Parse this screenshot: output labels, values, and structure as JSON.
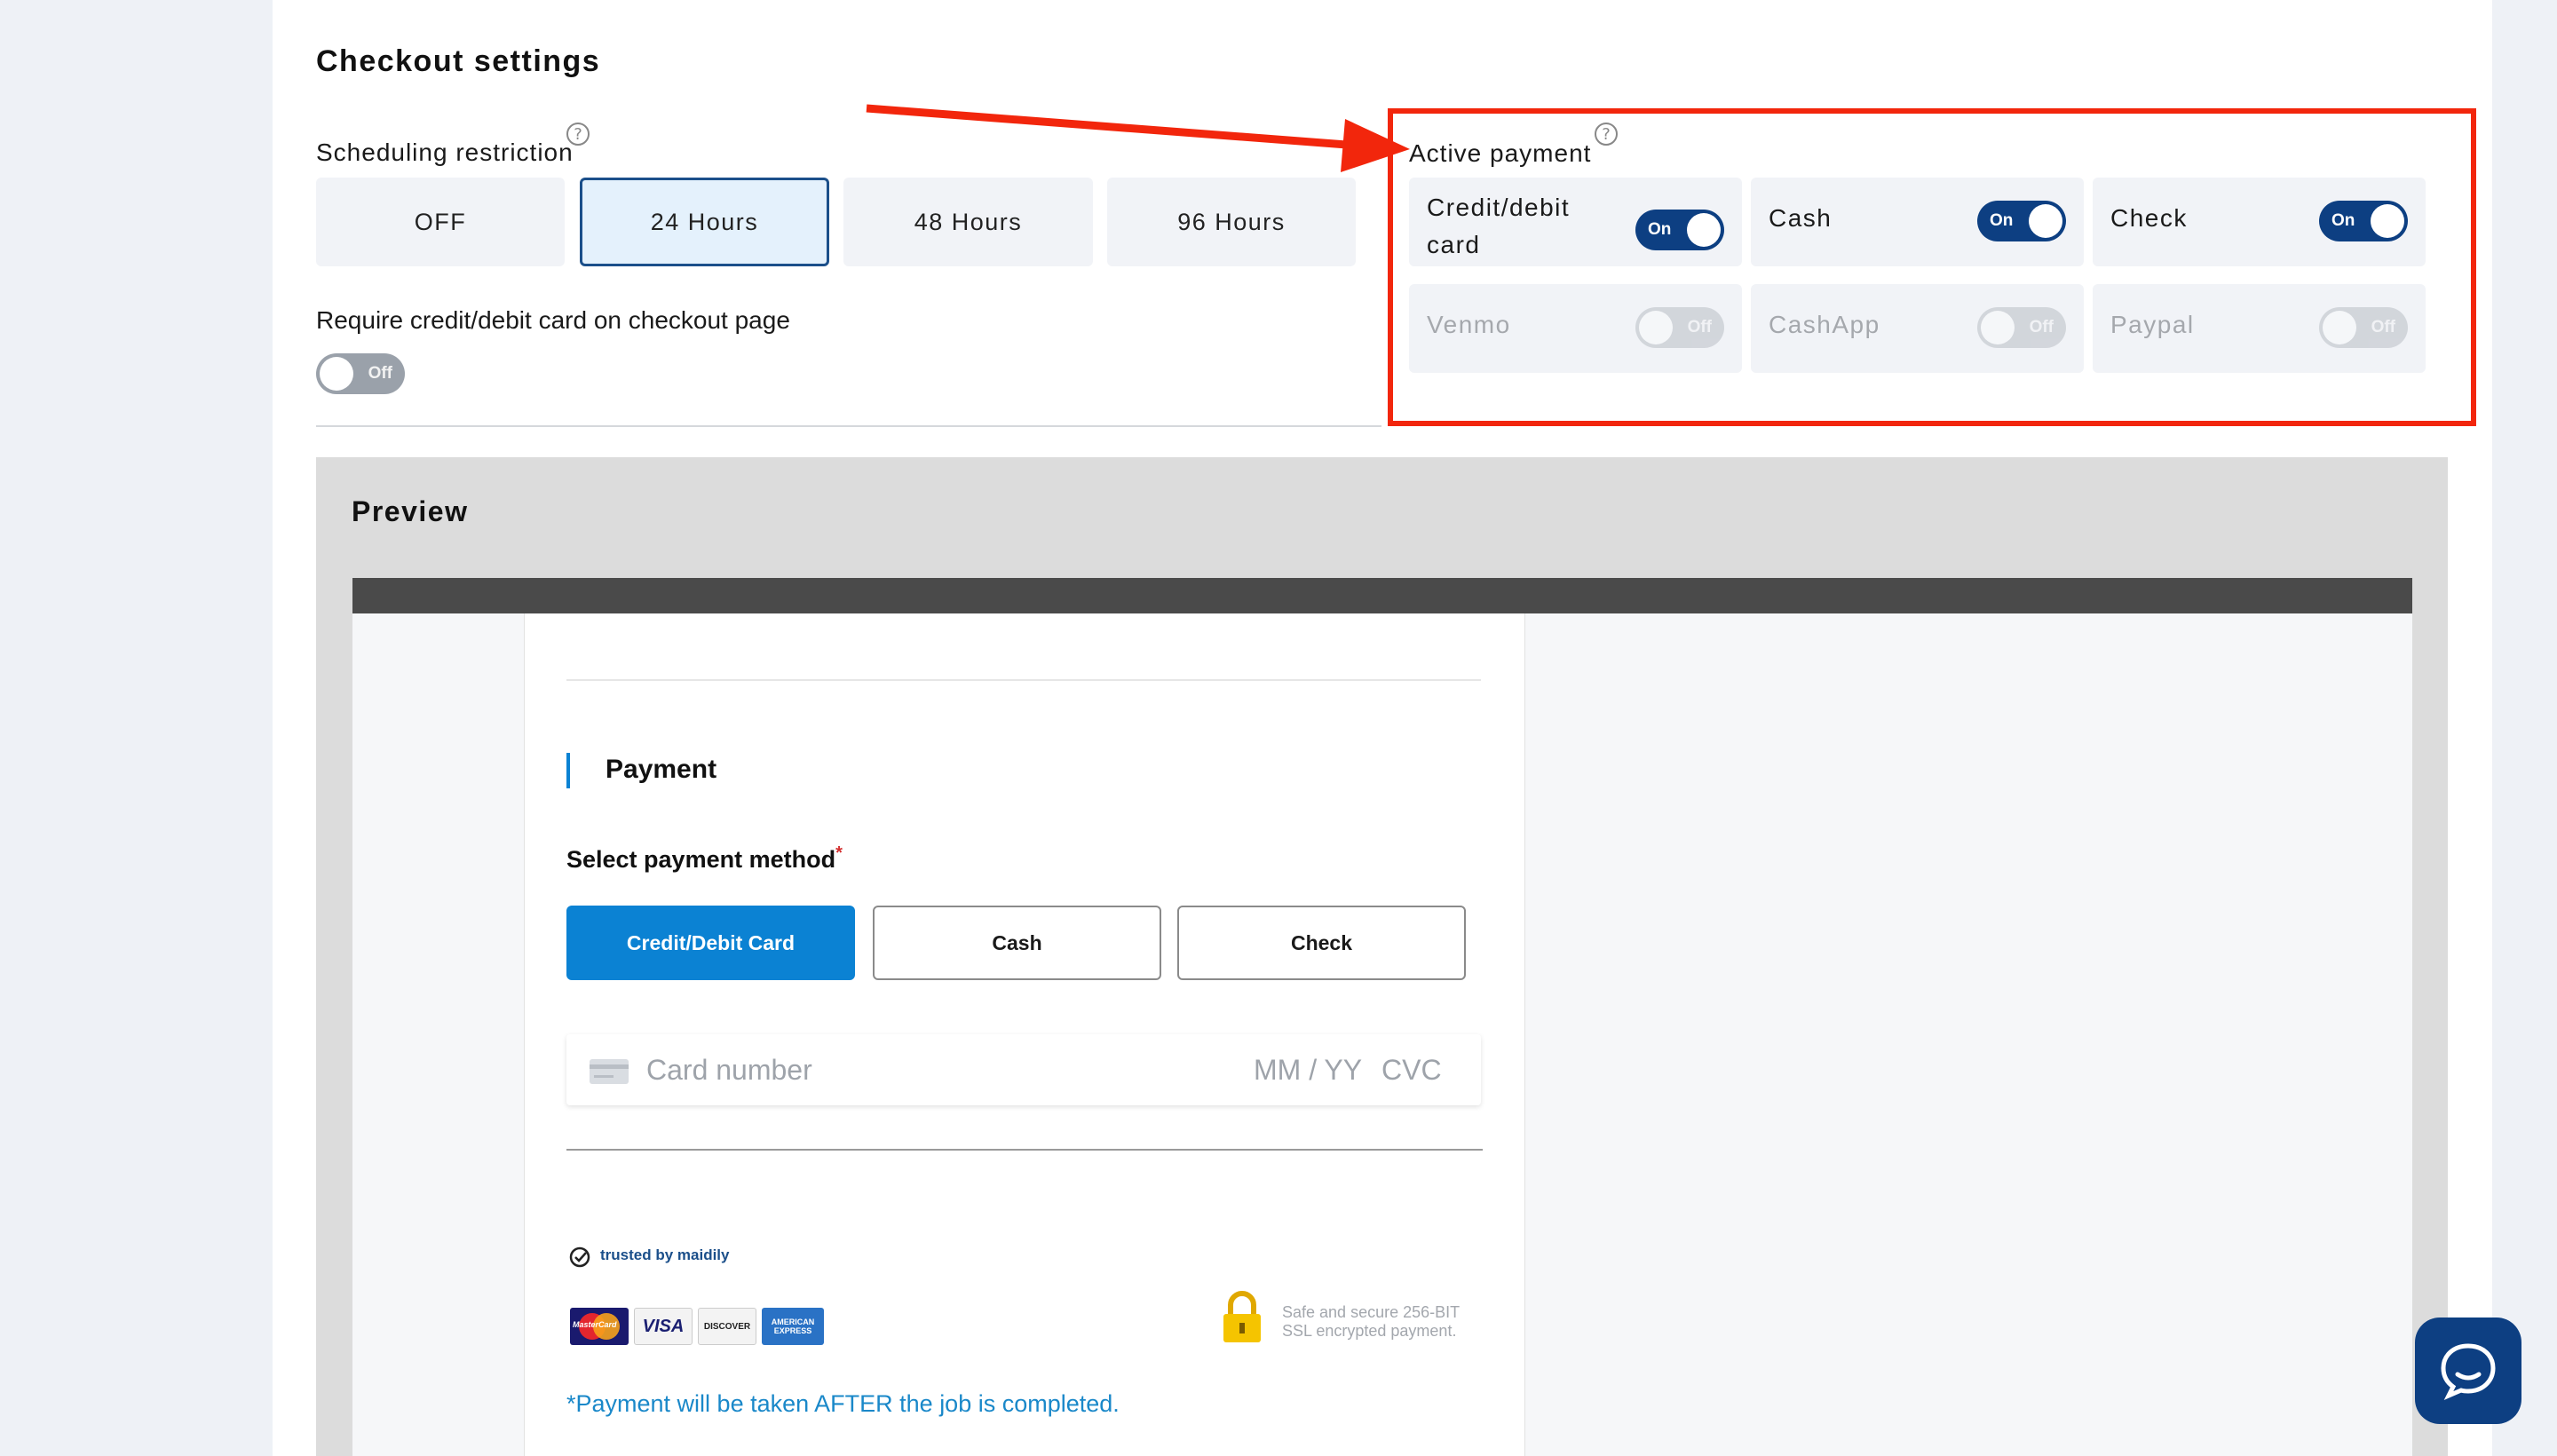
{
  "checkout": {
    "title": "Checkout settings",
    "scheduling_label": "Scheduling restriction",
    "help_glyph": "?",
    "scheduling_options": [
      "OFF",
      "24 Hours",
      "48 Hours",
      "96 Hours"
    ],
    "scheduling_selected": "24 Hours",
    "require_card_label": "Require credit/debit card on checkout page",
    "require_card_toggle": "Off"
  },
  "active_payment": {
    "label": "Active payment",
    "methods": [
      {
        "name": "Credit/debit card",
        "line1": "Credit/debit",
        "line2": "card",
        "state": "On"
      },
      {
        "name": "Cash",
        "state": "On"
      },
      {
        "name": "Check",
        "state": "On"
      },
      {
        "name": "Venmo",
        "state": "Off"
      },
      {
        "name": "CashApp",
        "state": "Off"
      },
      {
        "name": "Paypal",
        "state": "Off"
      }
    ]
  },
  "preview": {
    "title": "Preview",
    "section_title": "Payment",
    "select_label": "Select payment method",
    "required_mark": "*",
    "methods": [
      "Credit/Debit Card",
      "Cash",
      "Check"
    ],
    "selected_method": "Credit/Debit Card",
    "card_placeholder": "Card number",
    "expiry_placeholder": "MM / YY",
    "cvc_placeholder": "CVC",
    "trusted_text": "trusted by maidily",
    "card_brands": [
      "MasterCard",
      "VISA",
      "DISCOVER",
      "AMERICAN EXPRESS"
    ],
    "secure_line1": "Safe and secure 256-BIT",
    "secure_line2": "SSL encrypted payment.",
    "note": "*Payment will be taken AFTER the job is completed."
  },
  "colors": {
    "accent_navy": "#0d3f82",
    "accent_blue": "#0b82d3",
    "annotation_red": "#f2260c",
    "toggle_off": "#9aa1aa"
  },
  "icons": {
    "help": "question-circle-icon",
    "chat": "chat-bubble-icon",
    "lock": "padlock-icon",
    "check": "check-circle-icon",
    "card": "credit-card-icon"
  }
}
